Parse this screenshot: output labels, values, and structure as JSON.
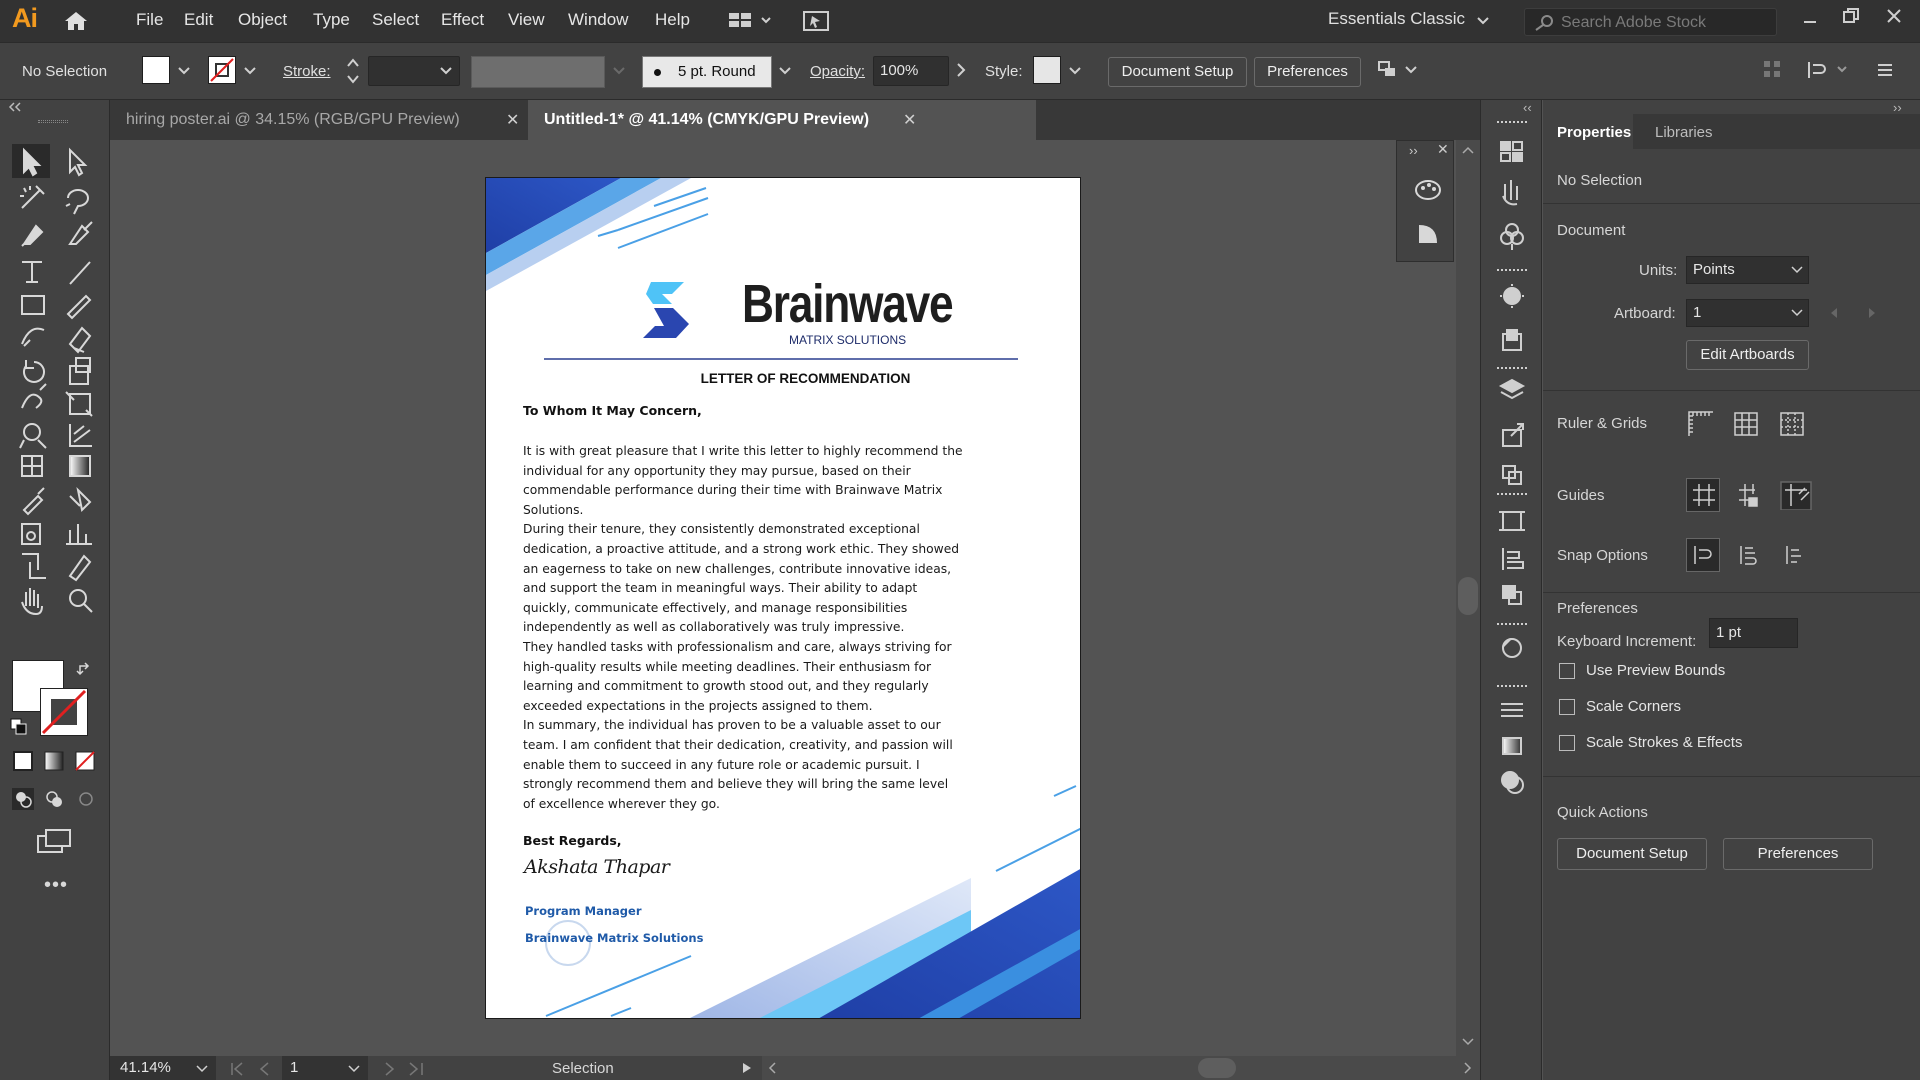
{
  "app": {
    "logo": "Ai",
    "menus": [
      "File",
      "Edit",
      "Object",
      "Type",
      "Select",
      "Effect",
      "View",
      "Window",
      "Help"
    ],
    "workspace": "Essentials Classic",
    "search_placeholder": "Search Adobe Stock"
  },
  "control_bar": {
    "selection": "No Selection",
    "stroke_label": "Stroke:",
    "brush": "5 pt. Round",
    "opacity_label": "Opacity:",
    "opacity_value": "100%",
    "style_label": "Style:",
    "document_setup": "Document Setup",
    "preferences": "Preferences"
  },
  "tabs": [
    {
      "label": "hiring poster.ai @ 34.15% (RGB/GPU Preview)",
      "active": false
    },
    {
      "label": "Untitled-1* @ 41.14% (CMYK/GPU Preview)",
      "active": true
    }
  ],
  "document": {
    "brand": "Brainwave",
    "brand_sub": "MATRIX SOLUTIONS",
    "heading": "LETTER OF RECOMMENDATION",
    "salutation": "To Whom It May Concern,",
    "lines": [
      "It is with great pleasure that I write this letter to highly recommend the",
      "individual for any opportunity they may pursue, based on their",
      "commendable performance during their time with Brainwave Matrix",
      "Solutions.",
      "During their tenure, they consistently demonstrated exceptional",
      "dedication, a proactive attitude, and a strong work ethic. They showed",
      "an eagerness to take on new challenges, contribute innovative ideas,",
      "and support the team in meaningful ways. Their ability to adapt",
      "quickly, communicate effectively, and manage responsibilities",
      "independently as well as collaboratively was truly impressive.",
      "They handled tasks with professionalism and care, always striving for",
      "high-quality results while meeting deadlines. Their enthusiasm for",
      "learning and commitment to growth stood out, and they regularly",
      "exceeded expectations in the projects assigned to them.",
      "In summary, the individual has proven to be a valuable asset to our",
      "team. I am confident that their dedication, creativity, and passion will",
      "enable them to succeed in any future role or academic pursuit. I",
      "strongly recommend them and believe they will bring the same level",
      "of excellence wherever they go."
    ],
    "closing": "Best Regards,",
    "signature": "Akshata Thapar",
    "signer_title": "Program Manager",
    "signer_org": "Brainwave Matrix Solutions"
  },
  "status": {
    "zoom": "41.14%",
    "artboard": "1",
    "tool": "Selection"
  },
  "properties": {
    "tab_properties": "Properties",
    "tab_libraries": "Libraries",
    "selection": "No Selection",
    "document_title": "Document",
    "units_label": "Units:",
    "units_value": "Points",
    "artboard_label": "Artboard:",
    "artboard_value": "1",
    "edit_artboards": "Edit Artboards",
    "ruler_grids": "Ruler & Grids",
    "guides": "Guides",
    "snap_options": "Snap Options",
    "preferences_title": "Preferences",
    "keyboard_increment_label": "Keyboard Increment:",
    "keyboard_increment_value": "1 pt",
    "use_preview_bounds": "Use Preview Bounds",
    "scale_corners": "Scale Corners",
    "scale_strokes": "Scale Strokes & Effects",
    "quick_actions": "Quick Actions",
    "qa_document_setup": "Document Setup",
    "qa_preferences": "Preferences"
  }
}
